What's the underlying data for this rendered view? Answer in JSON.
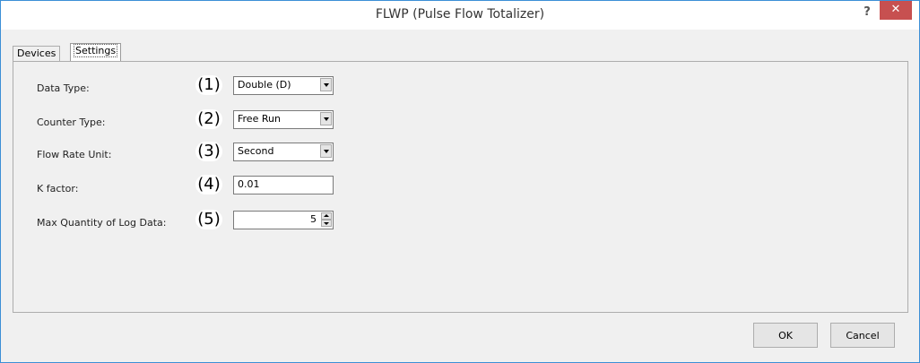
{
  "window": {
    "title": "FLWP (Pulse Flow Totalizer)",
    "help_label": "?",
    "close_label": "✕"
  },
  "tabs": [
    {
      "label": "Devices"
    },
    {
      "label": "Settings"
    }
  ],
  "fields": [
    {
      "label": "Data Type:",
      "badge": "(1)",
      "value": "Double (D)"
    },
    {
      "label": "Counter Type:",
      "badge": "(2)",
      "value": "Free Run"
    },
    {
      "label": "Flow Rate Unit:",
      "badge": "(3)",
      "value": "Second"
    },
    {
      "label": "K factor:",
      "badge": "(4)",
      "value": "0.01"
    },
    {
      "label": "Max Quantity of Log Data:",
      "badge": "(5)",
      "value": "5"
    }
  ],
  "buttons": {
    "ok": "OK",
    "cancel": "Cancel"
  }
}
